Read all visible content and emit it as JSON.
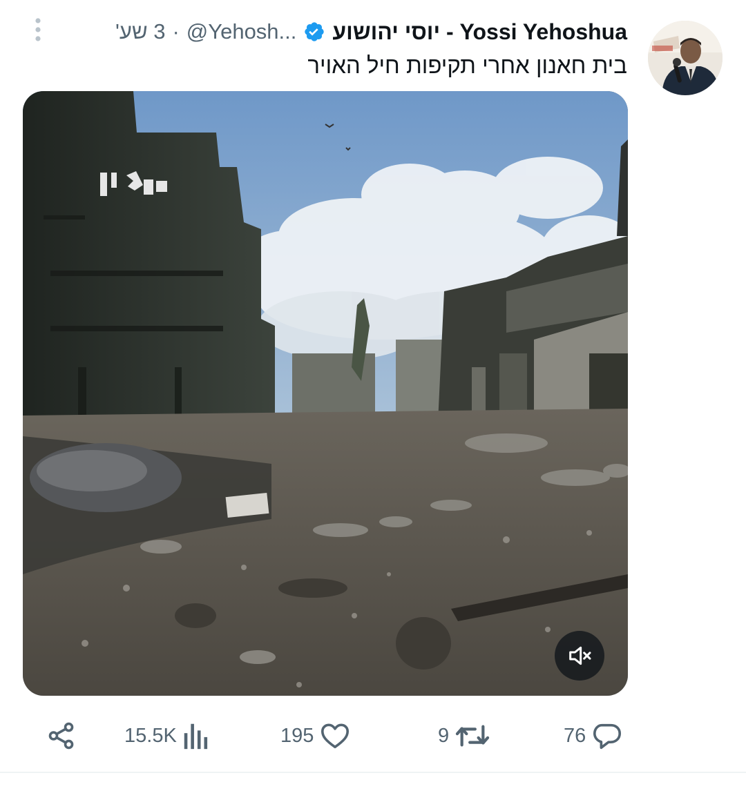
{
  "tweet": {
    "author": {
      "display_name": "Yossi Yehoshua - יוסי יהושוע",
      "handle": "@Yehosh...",
      "separator": "·",
      "timestamp": "3 שע'",
      "verified": true,
      "avatar_icon": "profile-photo-icon"
    },
    "text": "בית חאנון אחרי תקיפות חיל האויר",
    "media": {
      "type": "video",
      "mute_icon": "speaker-muted-icon"
    },
    "actions": {
      "share_icon": "share-icon",
      "views": "15.5K",
      "views_icon": "bar-chart-icon",
      "likes": "195",
      "likes_icon": "heart-icon",
      "retweets": "9",
      "retweets_icon": "retweet-icon",
      "replies": "76",
      "replies_icon": "speech-bubble-icon"
    },
    "colors": {
      "text_primary": "#0f1419",
      "text_secondary": "#536471",
      "verified_blue": "#1d9bf0"
    }
  }
}
